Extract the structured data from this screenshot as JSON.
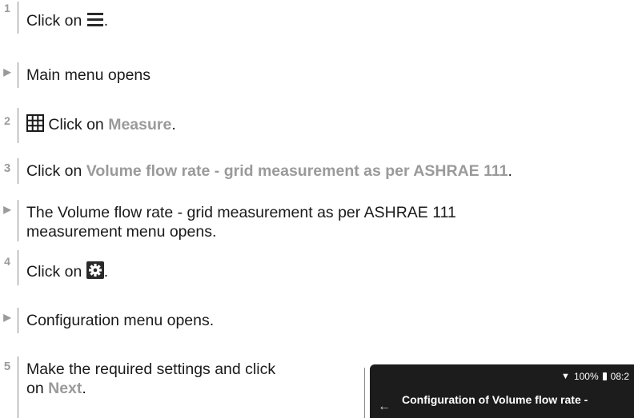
{
  "steps": [
    {
      "marker": "1",
      "text": "Click on ",
      "tail": ".",
      "icon": "hamburger-menu-icon"
    },
    {
      "marker": "▶",
      "text": "Main menu opens"
    },
    {
      "marker": "2",
      "icon": "grid-icon",
      "text": " Click on ",
      "kw": "Measure",
      "tail": "."
    },
    {
      "marker": "3",
      "text": "Click on ",
      "kw": "Volume flow rate - grid measurement as per ASHRAE 111",
      "tail": "."
    },
    {
      "marker": "▶",
      "line1": "The Volume flow rate - grid measurement as per ASHRAE 111",
      "line2": "measurement menu opens."
    },
    {
      "marker": "4",
      "text": "Click on ",
      "tail": ".",
      "icon": "settings-gear-icon"
    },
    {
      "marker": "▶",
      "text": "Configuration menu opens."
    },
    {
      "marker": "5",
      "line1": "Make the required settings and click",
      "line2_pre": "on ",
      "kw": "Next",
      "tail": "."
    }
  ],
  "device": {
    "wifi": "▼",
    "battery_level": "100%",
    "time": "08:2",
    "back_icon": "←",
    "title": "Configuration of Volume flow rate -"
  }
}
